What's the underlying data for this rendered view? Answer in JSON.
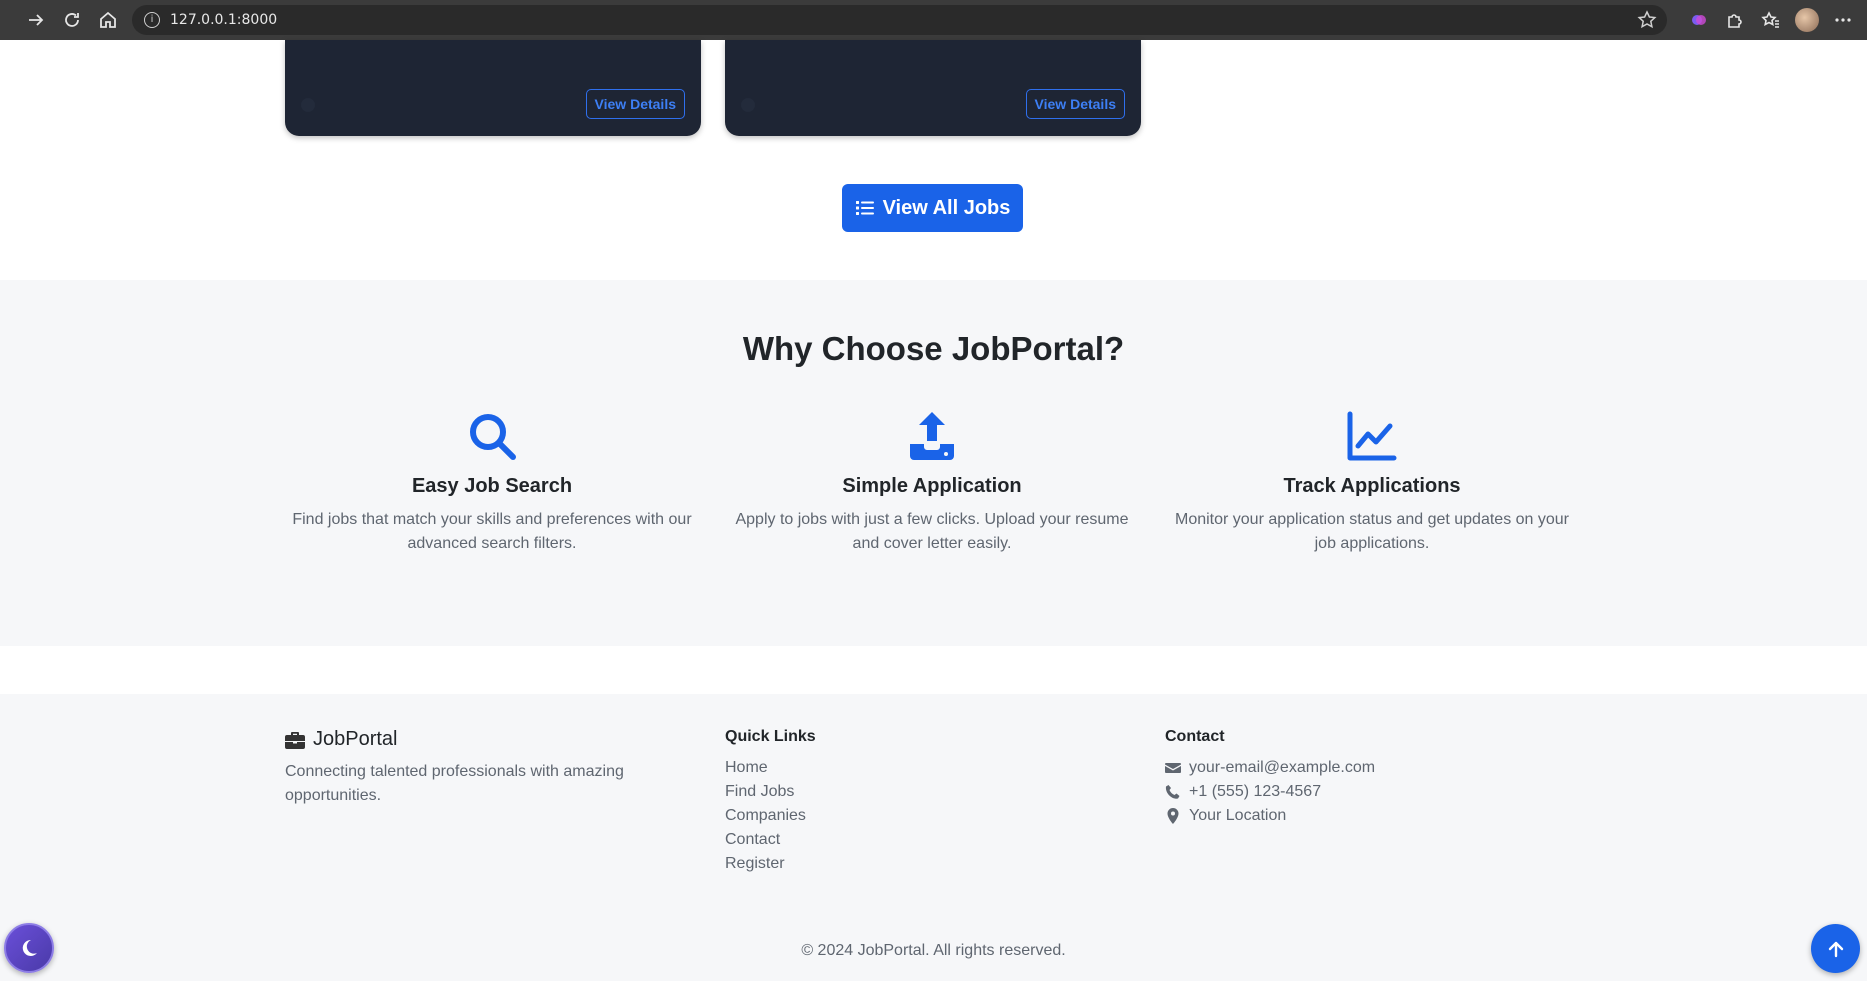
{
  "browser": {
    "url": "127.0.0.1:8000"
  },
  "cards": [
    {
      "details_label": "View Details"
    },
    {
      "details_label": "View Details"
    }
  ],
  "view_all_label": "View All Jobs",
  "why": {
    "title": "Why Choose JobPortal?",
    "features": [
      {
        "icon": "search-icon",
        "title": "Easy Job Search",
        "desc": "Find jobs that match your skills and preferences with our advanced search filters."
      },
      {
        "icon": "upload-icon",
        "title": "Simple Application",
        "desc": "Apply to jobs with just a few clicks. Upload your resume and cover letter easily."
      },
      {
        "icon": "chart-line-icon",
        "title": "Track Applications",
        "desc": "Monitor your application status and get updates on your job applications."
      }
    ]
  },
  "footer": {
    "brand": "JobPortal",
    "brand_desc": "Connecting talented professionals with amazing opportunities.",
    "quick_links_title": "Quick Links",
    "quick_links": [
      "Home",
      "Find Jobs",
      "Companies",
      "Contact",
      "Register"
    ],
    "contact_title": "Contact",
    "email": "your-email@example.com",
    "phone": "+1 (555) 123-4567",
    "location": "Your Location",
    "copyright": "© 2024 JobPortal. All rights reserved."
  },
  "colors": {
    "primary": "#1a63e8",
    "card_bg": "#1e2534",
    "section_bg": "#f6f7f9"
  }
}
